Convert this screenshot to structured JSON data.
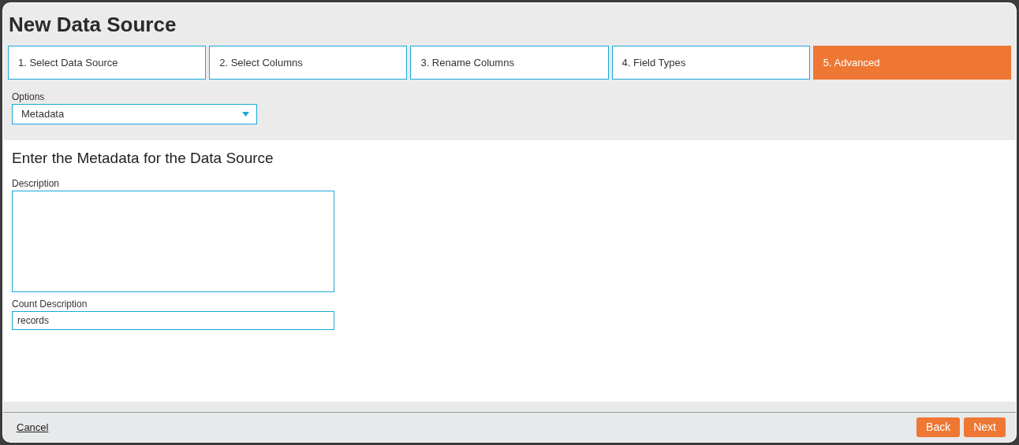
{
  "title": "New Data Source",
  "steps": [
    {
      "label": "1. Select Data Source",
      "selected": false
    },
    {
      "label": "2. Select Columns",
      "selected": false
    },
    {
      "label": "3. Rename Columns",
      "selected": false
    },
    {
      "label": "4. Field Types",
      "selected": false
    },
    {
      "label": "5. Advanced",
      "selected": true
    }
  ],
  "options": {
    "label": "Options",
    "value": "Metadata"
  },
  "section_heading": "Enter the Metadata for the Data Source",
  "description": {
    "label": "Description"
  },
  "count_description": {
    "label": "Count Description",
    "value": "records"
  },
  "footer": {
    "cancel": "Cancel",
    "buttons": [
      "Back",
      "Next"
    ]
  }
}
